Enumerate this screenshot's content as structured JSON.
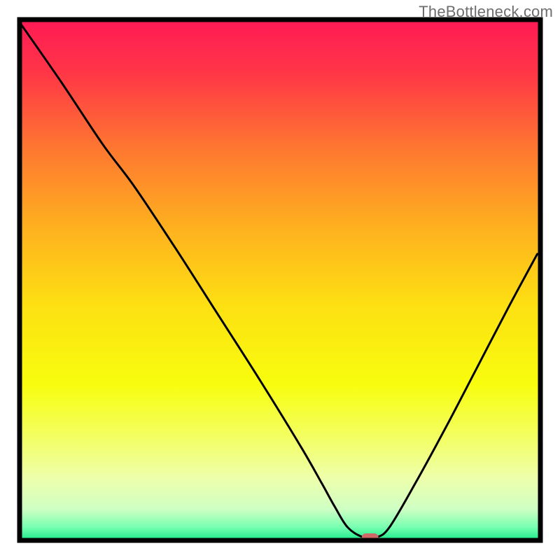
{
  "watermark": "TheBottleneck.com",
  "chart_data": {
    "type": "line",
    "title": "",
    "xlabel": "",
    "ylabel": "",
    "xlim": [
      0,
      100
    ],
    "ylim": [
      0,
      100
    ],
    "grid": false,
    "background": {
      "type": "vertical-gradient",
      "stops": [
        {
          "offset": 0.0,
          "color": "#ff1a55"
        },
        {
          "offset": 0.1,
          "color": "#ff3547"
        },
        {
          "offset": 0.25,
          "color": "#fe7830"
        },
        {
          "offset": 0.4,
          "color": "#feb11f"
        },
        {
          "offset": 0.55,
          "color": "#fde012"
        },
        {
          "offset": 0.7,
          "color": "#f8fd0e"
        },
        {
          "offset": 0.8,
          "color": "#f3ff61"
        },
        {
          "offset": 0.88,
          "color": "#eeffab"
        },
        {
          "offset": 0.94,
          "color": "#cfffc4"
        },
        {
          "offset": 0.975,
          "color": "#76ffb0"
        },
        {
          "offset": 1.0,
          "color": "#19e989"
        }
      ]
    },
    "border_color": "#000000",
    "series": [
      {
        "name": "bottleneck-curve",
        "color": "#000000",
        "x": [
          0.0,
          8.0,
          16.0,
          22.0,
          30.0,
          38.0,
          46.0,
          54.0,
          58.0,
          60.5,
          63.0,
          66.0,
          68.5,
          71.0,
          76.0,
          82.0,
          88.0,
          94.0,
          99.4
        ],
        "y": [
          99.5,
          88.0,
          76.0,
          68.0,
          56.0,
          43.5,
          31.0,
          18.0,
          11.0,
          6.5,
          2.5,
          0.6,
          0.6,
          2.5,
          11.0,
          22.0,
          33.5,
          45.0,
          55.0
        ]
      }
    ],
    "marker": {
      "name": "optimal-point",
      "x": 67.3,
      "y": 0.6,
      "width": 3.2,
      "height": 1.5,
      "color": "#d16868"
    }
  }
}
